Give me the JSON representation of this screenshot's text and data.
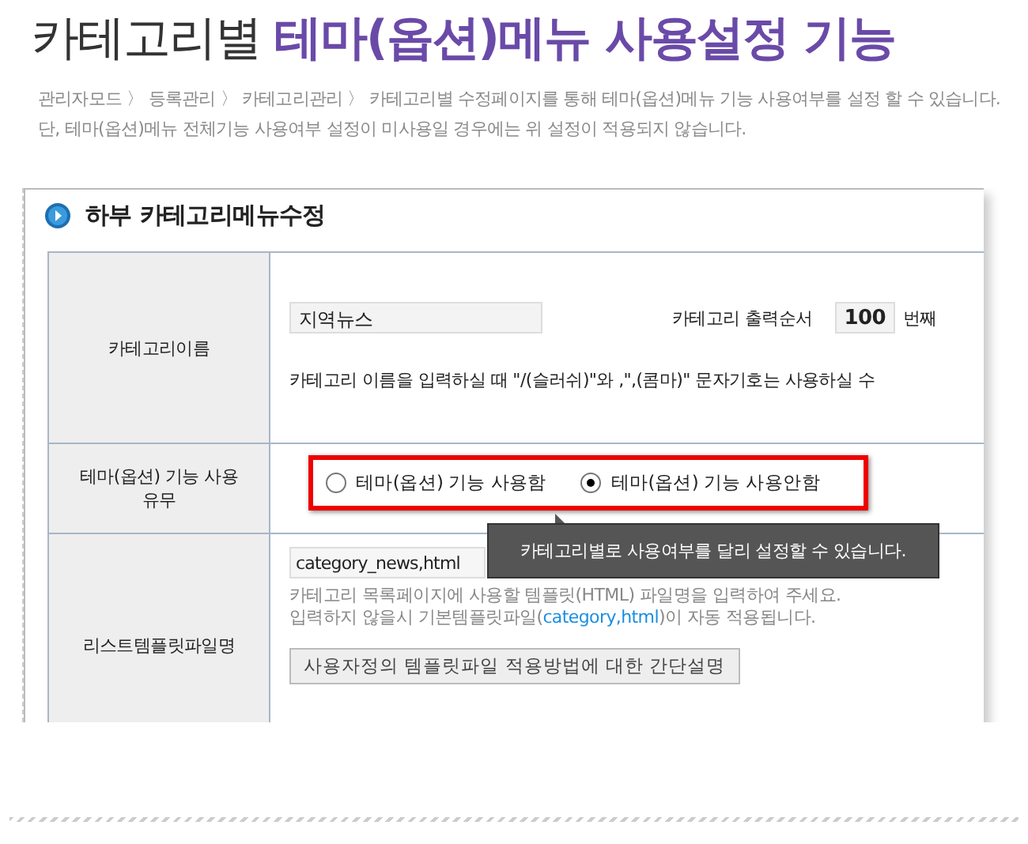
{
  "heading": {
    "plain": "카테고리별",
    "accent": "테마(옵션)메뉴 사용설정 기능"
  },
  "description": "관리자모드 〉 등록관리 〉 카테고리관리 〉 카테고리별 수정페이지를 통해 테마(옵션)메뉴 기능 사용여부를 설정 할 수 있습니다.  단, 테마(옵션)메뉴 전체기능 사용여부 설정이 미사용일 경우에는 위 설정이 적용되지 않습니다.",
  "panel": {
    "title": "하부 카테고리메뉴수정",
    "rows": [
      {
        "kind": "name",
        "label": "카테고리이름",
        "value": "지역뉴스",
        "order_label": "카테고리 출력순서",
        "order_value": "100",
        "order_unit": "번째",
        "note": "카테고리 이름을 입력하실 때 \"/(슬러쉬)\"와 ,\",(콤마)\" 문자기호는 사용하실 수"
      },
      {
        "kind": "radio",
        "label": "테마(옵션) 기능 사용유무",
        "options": [
          {
            "label": "테마(옵션) 기능 사용함",
            "selected": false
          },
          {
            "label": "테마(옵션) 기능 사용안함",
            "selected": true
          }
        ],
        "tooltip": "카테고리별로 사용여부를 달리 설정할 수 있습니다."
      },
      {
        "kind": "template",
        "label": "리스트템플릿파일명",
        "value": "category_news,html",
        "hint_line_1": "카테고리 목록페이지에 사용할 템플릿(HTML) 파일명을 입력하여 주세요.",
        "hint_line_2_start": "입력하지 않을시 기본템플릿파일(",
        "hint_link": "category,html",
        "hint_line_2_end": ")이 자동 적용됩니다.",
        "button": "사용자정의 템플릿파일 적용방법에 대한 간단설명"
      }
    ]
  }
}
